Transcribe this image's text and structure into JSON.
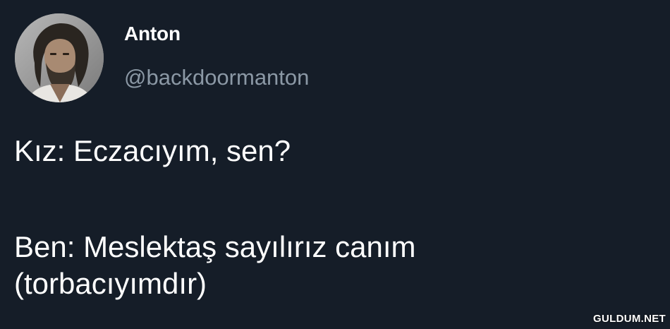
{
  "author": {
    "display_name": "Anton",
    "handle": "@backdoormanton",
    "avatar_icon": "bearded-man-photo"
  },
  "tweet": {
    "lines": [
      "Kız: Eczacıyım, sen?",
      "Ben: Meslektaş sayılırız canım",
      "(torbacıyımdır)"
    ]
  },
  "watermark": "GULDUM.NET",
  "colors": {
    "background": "#151d28",
    "text": "#ffffff",
    "handle": "#8b98a5"
  }
}
